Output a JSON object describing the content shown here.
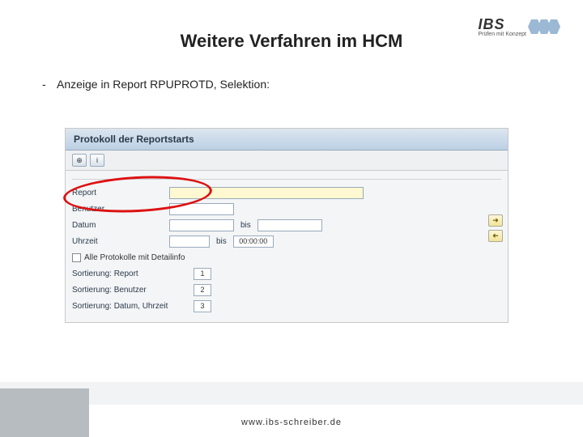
{
  "slide": {
    "title": "Weitere Verfahren im HCM",
    "bullet": "Anzeige in Report RPUPROTD, Selektion:"
  },
  "logo": {
    "name": "IBS",
    "sub": "Prüfen mit Konzept"
  },
  "sap": {
    "windowTitle": "Protokoll der Reportstarts",
    "toolbar": {
      "execIcon": "⊕",
      "infoIcon": "i"
    },
    "labels": {
      "report": "Report",
      "benutzer": "Benutzer",
      "datum": "Datum",
      "uhrzeit": "Uhrzeit",
      "bis1": "bis",
      "bis2": "bis",
      "timeDefault": "00:00:00",
      "checkbox": "Alle Protokolle mit Detailinfo",
      "sort1": "Sortierung: Report",
      "sort2": "Sortierung: Benutzer",
      "sort3": "Sortierung: Datum, Uhrzeit"
    },
    "sortValues": {
      "s1": "1",
      "s2": "2",
      "s3": "3"
    },
    "arrows": {
      "right": "➜",
      "left": "➜"
    }
  },
  "footer": {
    "url": "www.ibs-schreiber.de"
  }
}
